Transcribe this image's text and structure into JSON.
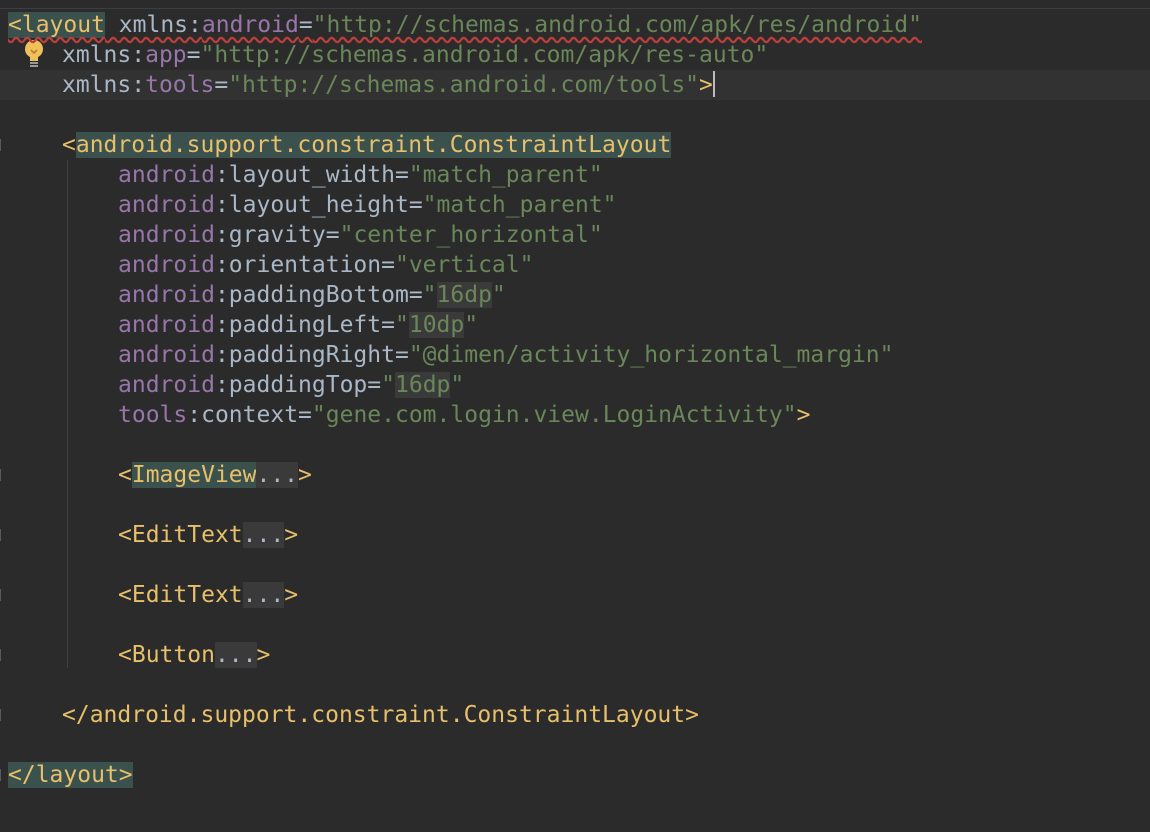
{
  "editor": {
    "lines": {
      "l1": {
        "open": "<layout",
        "attr": " xmlns:",
        "ns": "android",
        "eq": "=",
        "value": "\"http://schemas.android.com/apk/res/android\""
      },
      "l2": {
        "prefix": "xmlns:",
        "ns": "app",
        "eq": "=",
        "value": "\"http://schemas.android.com/apk/res-auto\""
      },
      "l3": {
        "prefix": "xmlns:",
        "ns": "tools",
        "eq": "=",
        "value": "\"http://schemas.android.com/tools\"",
        "close": ">"
      },
      "l4": {
        "open": "<",
        "tag": "android.support.constraint.ConstraintLayout"
      },
      "attrs": [
        {
          "ns": "android",
          "colon": ":",
          "name": "layout_width",
          "eq": "=",
          "value": "\"match_parent\""
        },
        {
          "ns": "android",
          "colon": ":",
          "name": "layout_height",
          "eq": "=",
          "value": "\"match_parent\""
        },
        {
          "ns": "android",
          "colon": ":",
          "name": "gravity",
          "eq": "=",
          "value": "\"center_horizontal\""
        },
        {
          "ns": "android",
          "colon": ":",
          "name": "orientation",
          "eq": "=",
          "value": "\"vertical\""
        },
        {
          "ns": "android",
          "colon": ":",
          "name": "paddingBottom",
          "eq": "=",
          "q1": "\"",
          "value": "16dp",
          "q2": "\""
        },
        {
          "ns": "android",
          "colon": ":",
          "name": "paddingLeft",
          "eq": "=",
          "q1": "\"",
          "value": "10dp",
          "q2": "\""
        },
        {
          "ns": "android",
          "colon": ":",
          "name": "paddingRight",
          "eq": "=",
          "value": "\"@dimen/activity_horizontal_margin\""
        },
        {
          "ns": "android",
          "colon": ":",
          "name": "paddingTop",
          "eq": "=",
          "q1": "\"",
          "value": "16dp",
          "q2": "\""
        },
        {
          "ns": "tools",
          "colon": ":",
          "name": "context",
          "eq": "=",
          "value": "\"gene.com.login.view.LoginActivity\"",
          "close": ">"
        }
      ],
      "children": [
        {
          "open": "<",
          "tag": "ImageView",
          "fold": "...",
          "close": ">"
        },
        {
          "open": "<",
          "tag": "EditText",
          "fold": "...",
          "close": ">"
        },
        {
          "open": "<",
          "tag": "EditText",
          "fold": "...",
          "close": ">"
        },
        {
          "open": "<",
          "tag": "Button",
          "fold": "...",
          "close": ">"
        }
      ],
      "close_inner": "</android.support.constraint.ConstraintLayout>",
      "close_outer": "</layout>"
    }
  },
  "colors": {
    "background": "#2b2b2b",
    "tag": "#e8bf6a",
    "namespace": "#9876aa",
    "string": "#6a8759",
    "text": "#a9b7c6",
    "highlight": "#3b514d"
  },
  "icons": {
    "intention": "lightbulb-icon"
  }
}
